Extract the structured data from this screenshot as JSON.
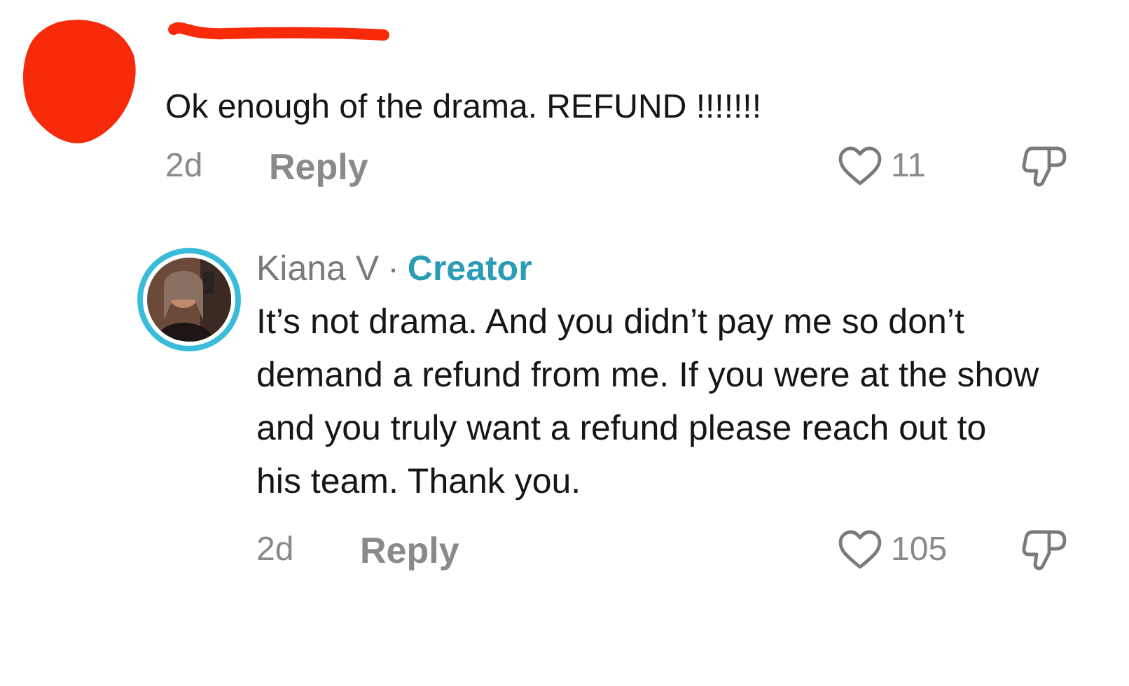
{
  "comments": [
    {
      "avatar": {
        "kind": "redacted"
      },
      "text": "Ok enough of the drama. REFUND !!!!!!!",
      "time": "2d",
      "reply_label": "Reply",
      "likes": "11",
      "liked": false,
      "disliked": false,
      "replies": [
        {
          "author": "Kiana V",
          "separator": "·",
          "badge": "Creator",
          "text": "It’s not drama. And you didn’t pay me so don’t demand a refund from me. If you were at the show and you truly want a refund please reach out to his team. Thank you.",
          "time": "2d",
          "reply_label": "Reply",
          "likes": "105",
          "liked": false,
          "disliked": false
        }
      ]
    }
  ]
}
